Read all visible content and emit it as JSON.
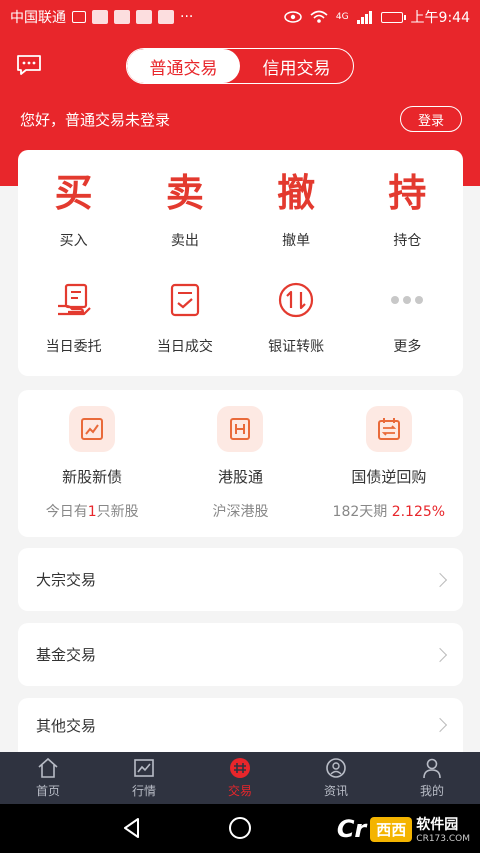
{
  "status_bar": {
    "carrier": "中国联通",
    "network": "4G",
    "time": "上午9:44"
  },
  "header": {
    "tabs": [
      {
        "label": "普通交易",
        "active": true
      },
      {
        "label": "信用交易",
        "active": false
      }
    ],
    "greeting": "您好，普通交易未登录",
    "login_label": "登录"
  },
  "quick_actions": [
    {
      "glyph": "买",
      "label": "买入"
    },
    {
      "glyph": "卖",
      "label": "卖出"
    },
    {
      "glyph": "撤",
      "label": "撤单"
    },
    {
      "glyph": "持",
      "label": "持仓"
    }
  ],
  "secondary_actions": [
    {
      "icon": "order-hand-icon",
      "label": "当日委托"
    },
    {
      "icon": "checklist-icon",
      "label": "当日成交"
    },
    {
      "icon": "transfer-icon",
      "label": "银证转账"
    },
    {
      "icon": "more-dots-icon",
      "label": "更多"
    }
  ],
  "features": [
    {
      "icon": "chart-up-icon",
      "title": "新股新债",
      "sub_prefix": "今日有",
      "sub_highlight": "1",
      "sub_suffix": "只新股"
    },
    {
      "icon": "hk-h-icon",
      "title": "港股通",
      "sub_prefix": "沪深港股",
      "sub_highlight": "",
      "sub_suffix": ""
    },
    {
      "icon": "repo-calendar-icon",
      "title": "国债逆回购",
      "sub_prefix": "182天期 ",
      "sub_highlight": "2.125%",
      "sub_suffix": ""
    }
  ],
  "list_items": [
    {
      "label": "大宗交易"
    },
    {
      "label": "基金交易"
    },
    {
      "label": "其他交易"
    }
  ],
  "bottom_nav": [
    {
      "icon": "home-icon",
      "label": "首页",
      "active": false
    },
    {
      "icon": "market-icon",
      "label": "行情",
      "active": false
    },
    {
      "icon": "trade-icon",
      "label": "交易",
      "active": true
    },
    {
      "icon": "news-icon",
      "label": "资讯",
      "active": false
    },
    {
      "icon": "profile-icon",
      "label": "我的",
      "active": false
    }
  ],
  "watermark": {
    "logo": "Cr",
    "badge": "西西",
    "name": "软件园",
    "domain": "CR173.COM"
  },
  "colors": {
    "brand_red": "#e8262b",
    "nav_bg": "#2f3340"
  }
}
